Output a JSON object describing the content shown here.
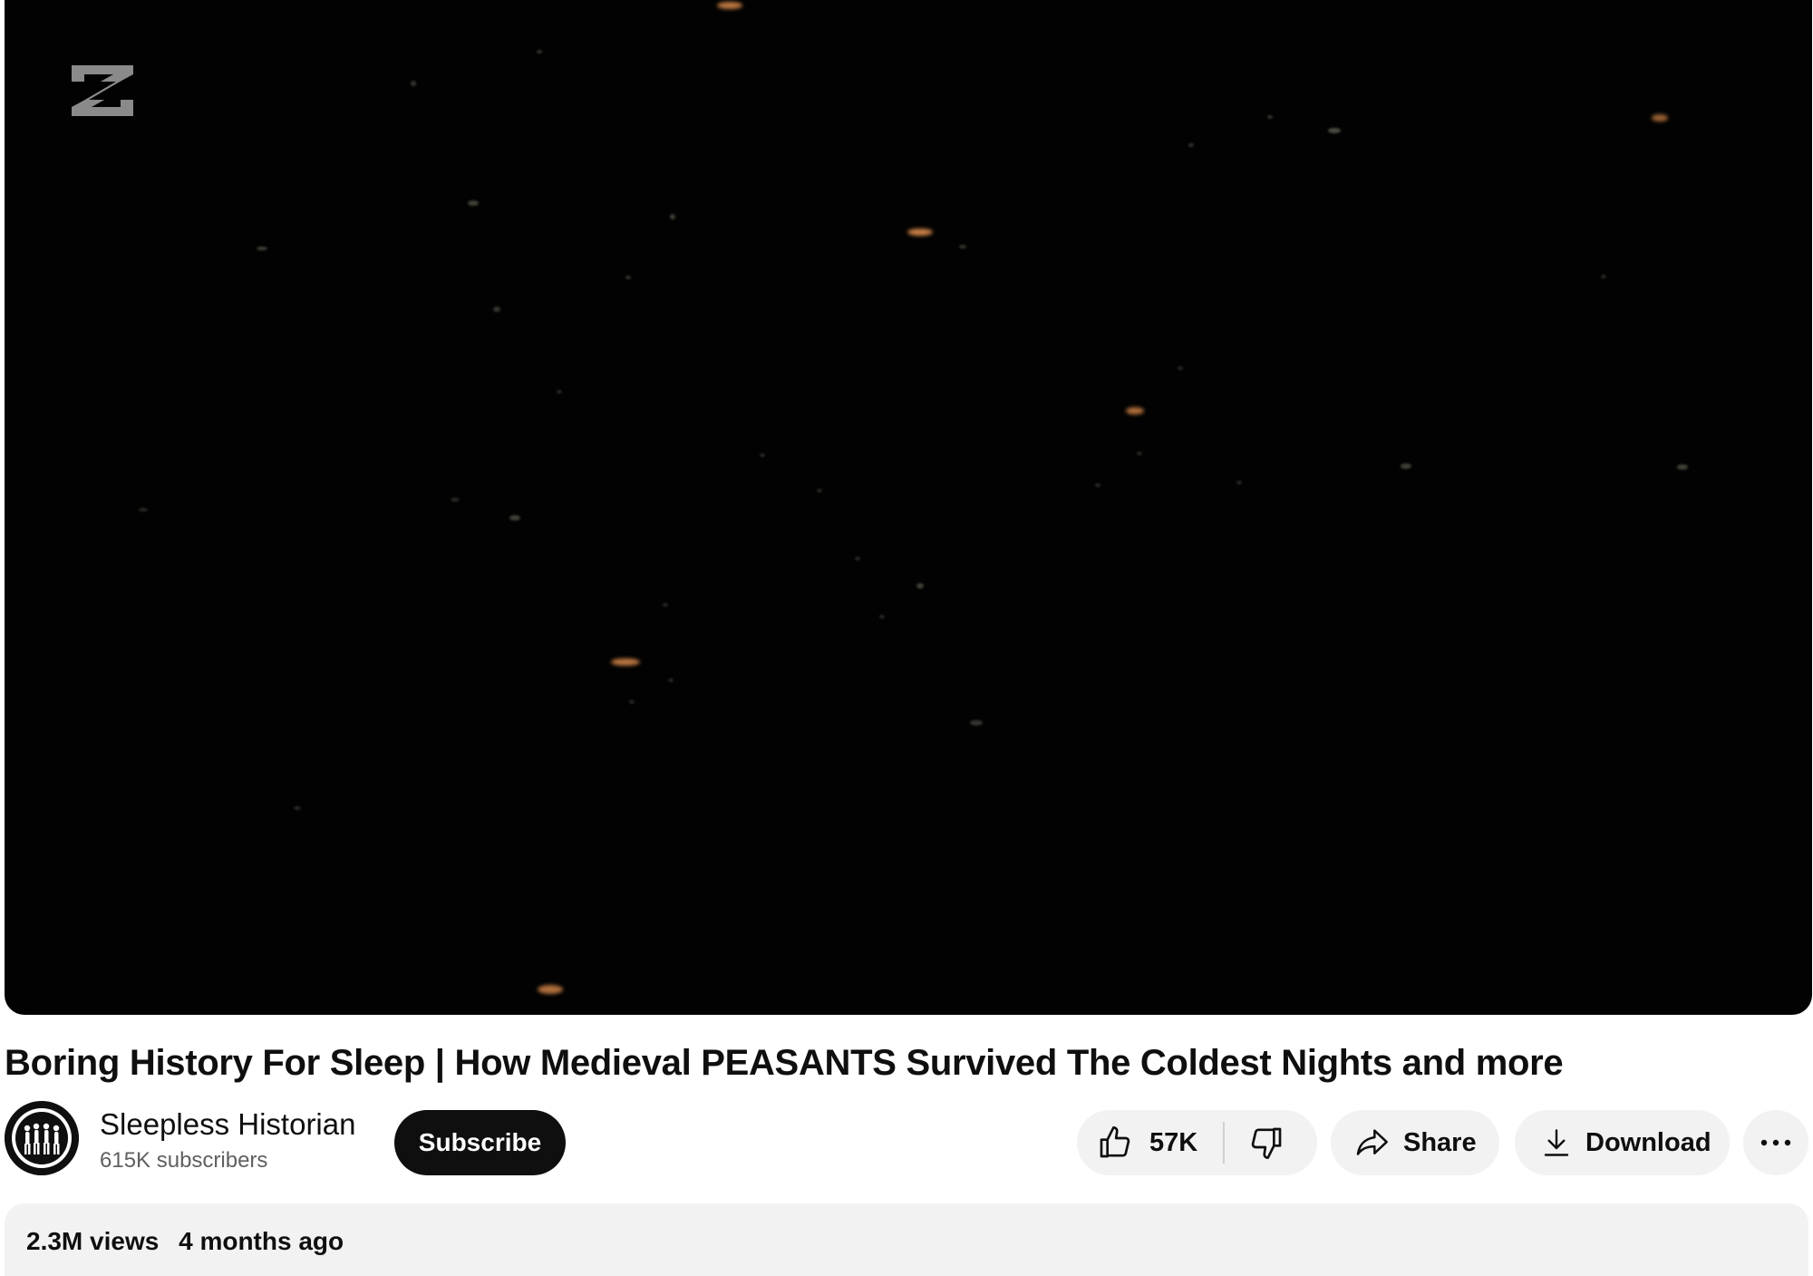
{
  "video": {
    "title": "Boring History For Sleep | How Medieval PEASANTS Survived The Coldest Nights and more",
    "watermark_icon": "capcut-logo-icon",
    "background_color": "#020202",
    "ember_color": "#d98a4a"
  },
  "channel": {
    "name": "Sleepless Historian",
    "subscribers": "615K subscribers",
    "avatar_icon": "silhouette-figures-icon"
  },
  "actions": {
    "subscribe_label": "Subscribe",
    "like_count": "57K",
    "like_icon": "thumbs-up-icon",
    "dislike_icon": "thumbs-down-icon",
    "share_label": "Share",
    "share_icon": "share-arrow-icon",
    "download_label": "Download",
    "download_icon": "download-icon",
    "more_icon": "more-horizontal-icon"
  },
  "description": {
    "views": "2.3M views",
    "age": "4 months ago"
  },
  "colors": {
    "subscribe_bg": "#0f0f0f",
    "pill_bg": "#f2f2f2",
    "text_primary": "#0f0f0f",
    "text_secondary": "#606060"
  }
}
